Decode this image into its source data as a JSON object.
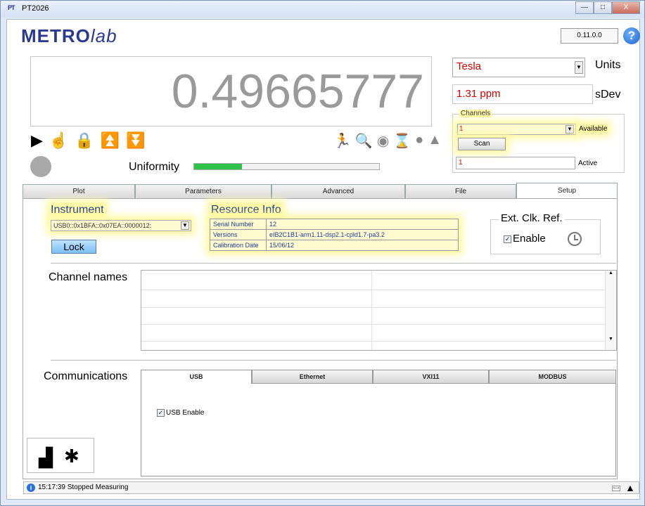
{
  "window": {
    "title": "PT2026",
    "app_icon": "PT"
  },
  "header": {
    "logo_main": "METRO",
    "logo_lab": "lab",
    "version": "0.11.0.0",
    "help_label": "?"
  },
  "measurement": {
    "value": "0.49665777",
    "units_value": "Tesla",
    "units_label": "Units",
    "sdev_value": "1.31 ppm",
    "sdev_label": "sDev"
  },
  "controls": {
    "play": "▶",
    "touch": "☝",
    "lock": "🔒",
    "top": "⏫",
    "bottom": "⏬"
  },
  "status_icons": {
    "run": "🏃",
    "search": "🔍",
    "gauge": "◉",
    "hourglass": "⌛",
    "alert_shield": "●",
    "warning": "▲"
  },
  "uniformity": {
    "label": "Uniformity",
    "level_fraction": 0.26
  },
  "channels": {
    "legend": "Channels",
    "available_value": "1",
    "available_label": "Available",
    "scan_label": "Scan",
    "active_value": "1",
    "active_label": "Active"
  },
  "tabs": [
    "Plot",
    "Parameters",
    "Advanced",
    "File",
    "Setup"
  ],
  "active_tab": "Setup",
  "instrument": {
    "label": "Instrument",
    "value": "USB0::0x1BFA::0x07EA::0000012:",
    "lock_label": "Lock"
  },
  "resource_info": {
    "label": "Resource Info",
    "rows": [
      {
        "key": "Serial Number",
        "value": "12"
      },
      {
        "key": "Versions",
        "value": "eIB2C1B1-arm1.11-dsp2.1-cpld1.7-pa3.2"
      },
      {
        "key": "Calibration Date",
        "value": "15/06/12"
      }
    ]
  },
  "ext_clk": {
    "label": "Ext. Clk. Ref.",
    "enable_label": "Enable",
    "enabled": true
  },
  "channel_names": {
    "label": "Channel names"
  },
  "communications": {
    "label": "Communications",
    "tabs": [
      "USB",
      "Ethernet",
      "VXI11",
      "MODBUS"
    ],
    "active_tab": "USB",
    "usb_enable_label": "USB Enable",
    "usb_enabled": true
  },
  "bottom_icons": {
    "factory": "factory-icon",
    "bug": "bug-icon"
  },
  "statusbar": {
    "text": "15:17:39 Stopped Measuring",
    "info": "i"
  },
  "colors": {
    "accent_red": "#d40000",
    "brand_blue": "#2b3a8f",
    "uniformity_green": "#2fc24a",
    "highlight_yellow": "#fff9a6"
  }
}
